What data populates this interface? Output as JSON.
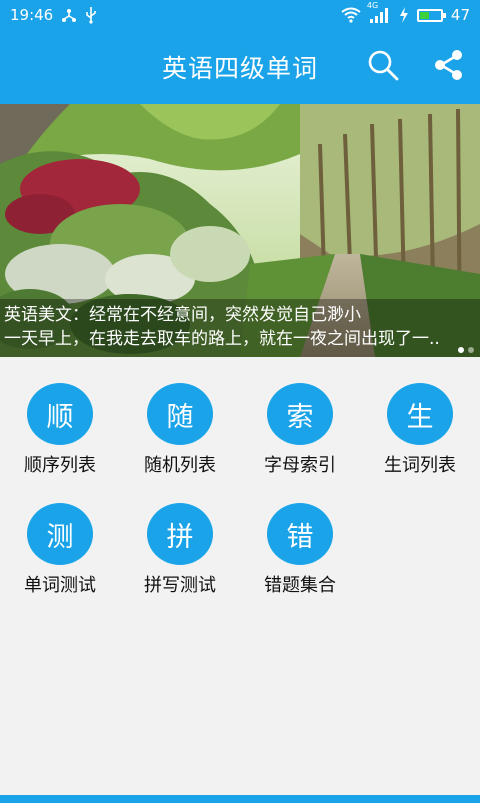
{
  "status_bar": {
    "time": "19:46",
    "network": "4G",
    "battery": "47",
    "battery_level": 0.47,
    "icons": [
      "usb-share-icon",
      "usb-icon",
      "wifi-icon",
      "signal-icon",
      "charging-icon",
      "battery-icon"
    ]
  },
  "app_bar": {
    "title": "英语四级单词",
    "search_icon": "search-icon",
    "share_icon": "share-icon"
  },
  "banner": {
    "caption_line1": "英语美文：经常在不经意间，突然发觉自己渺小",
    "caption_line2": "一天早上，在我走去取车的路上，就在一夜之间出现了一..",
    "page_count": 2,
    "active_page": 1
  },
  "menu": {
    "items": [
      {
        "glyph": "顺",
        "label": "顺序列表"
      },
      {
        "glyph": "随",
        "label": "随机列表"
      },
      {
        "glyph": "索",
        "label": "字母索引"
      },
      {
        "glyph": "生",
        "label": "生词列表"
      },
      {
        "glyph": "测",
        "label": "单词测试"
      },
      {
        "glyph": "拼",
        "label": "拼写测试"
      },
      {
        "glyph": "错",
        "label": "错题集合"
      }
    ]
  },
  "colors": {
    "primary": "#1aa3e8",
    "background": "#f2f2f2",
    "battery_fill": "#3ed13e"
  }
}
